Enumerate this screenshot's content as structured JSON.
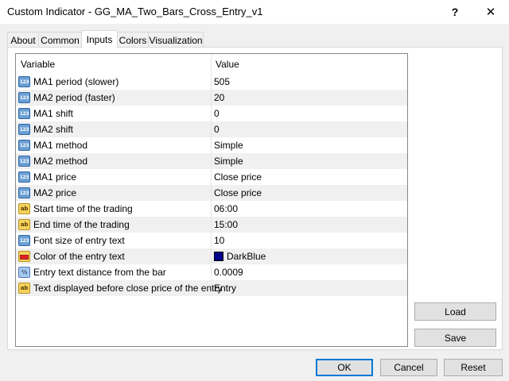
{
  "window": {
    "title": "Custom Indicator - GG_MA_Two_Bars_Cross_Entry_v1",
    "help_label": "?",
    "close_label": "✕"
  },
  "tabs": [
    {
      "label": "About"
    },
    {
      "label": "Common"
    },
    {
      "label": "Inputs",
      "active": true
    },
    {
      "label": "Colors"
    },
    {
      "label": "Visualization"
    }
  ],
  "table": {
    "headers": {
      "variable": "Variable",
      "value": "Value"
    },
    "rows": [
      {
        "icon": "integer-type-icon",
        "icon_text": "123",
        "variable": "MA1 period (slower)",
        "value": "505"
      },
      {
        "icon": "integer-type-icon",
        "icon_text": "123",
        "variable": "MA2 period (faster)",
        "value": "20"
      },
      {
        "icon": "integer-type-icon",
        "icon_text": "123",
        "variable": "MA1 shift",
        "value": "0"
      },
      {
        "icon": "integer-type-icon",
        "icon_text": "123",
        "variable": "MA2 shift",
        "value": "0"
      },
      {
        "icon": "integer-type-icon",
        "icon_text": "123",
        "variable": "MA1 method",
        "value": "Simple"
      },
      {
        "icon": "integer-type-icon",
        "icon_text": "123",
        "variable": "MA2 method",
        "value": "Simple"
      },
      {
        "icon": "integer-type-icon",
        "icon_text": "123",
        "variable": "MA1 price",
        "value": "Close price"
      },
      {
        "icon": "integer-type-icon",
        "icon_text": "123",
        "variable": "MA2 price",
        "value": "Close price"
      },
      {
        "icon": "string-type-icon",
        "icon_text": "ab",
        "variable": "Start time of the trading",
        "value": "06:00"
      },
      {
        "icon": "string-type-icon",
        "icon_text": "ab",
        "variable": "End time of the trading",
        "value": "15:00"
      },
      {
        "icon": "integer-type-icon",
        "icon_text": "123",
        "variable": "Font size of entry text",
        "value": "10"
      },
      {
        "icon": "color-type-icon",
        "icon_text": "",
        "variable": "Color of the entry text",
        "value": "DarkBlue",
        "swatch": "#00008b"
      },
      {
        "icon": "double-type-icon",
        "icon_text": "½",
        "variable": "Entry text distance from the bar",
        "value": "0.0009"
      },
      {
        "icon": "string-type-icon",
        "icon_text": "ab",
        "variable": "Text displayed before close price of the entry",
        "value": "Entry"
      }
    ]
  },
  "side_buttons": {
    "load": "Load",
    "save": "Save"
  },
  "footer_buttons": {
    "ok": "OK",
    "cancel": "Cancel",
    "reset": "Reset"
  },
  "colors": {
    "accent": "#0078d7",
    "alt_row": "#f0f0f0"
  }
}
